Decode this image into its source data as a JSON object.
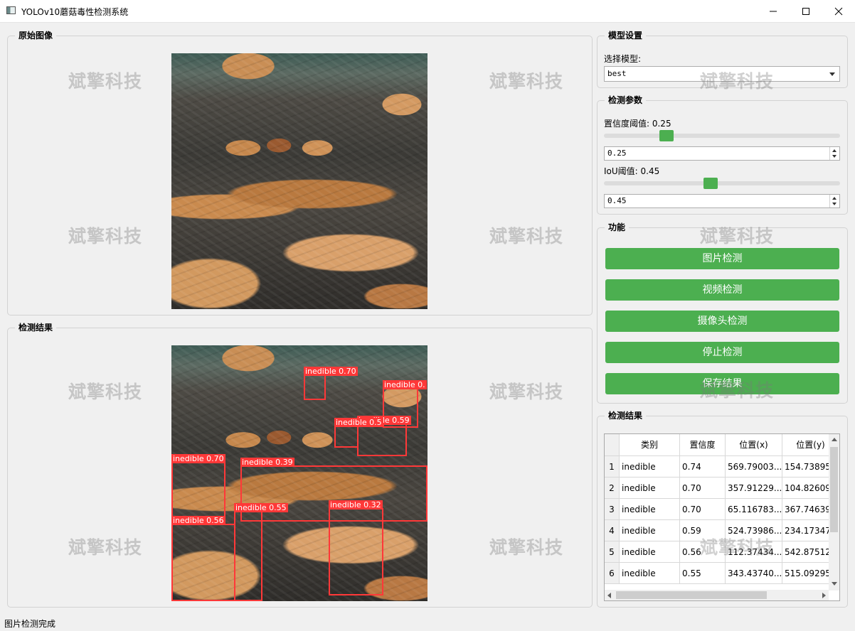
{
  "window": {
    "title": "YOLOv10蘑菇毒性检测系统"
  },
  "original_panel": {
    "title": "原始图像"
  },
  "result_panel": {
    "title": "检测结果",
    "detections": [
      {
        "label": "inedible 0.70"
      },
      {
        "label": "inedible 0."
      },
      {
        "label": "inedible 0.59"
      },
      {
        "label": "inedible 0.5"
      },
      {
        "label": "inedible 0.70"
      },
      {
        "label": "inedible 0.39"
      },
      {
        "label": "inedible 0.55"
      },
      {
        "label": "inedible 0.32"
      },
      {
        "label": "inedible 0.56"
      }
    ]
  },
  "watermark": "斌擎科技",
  "model_settings": {
    "title": "模型设置",
    "select_label": "选择模型:",
    "selected_model": "best"
  },
  "detect_params": {
    "title": "检测参数",
    "conf_label": "置信度阈值: 0.25",
    "conf_value": "0.25",
    "conf_fraction": 0.25,
    "iou_label": "IoU阈值: 0.45",
    "iou_value": "0.45",
    "iou_fraction": 0.45
  },
  "functions": {
    "title": "功能",
    "image_detect": "图片检测",
    "video_detect": "视频检测",
    "camera_detect": "摄像头检测",
    "stop_detect": "停止检测",
    "save_result": "保存结果"
  },
  "results_table": {
    "title": "检测结果",
    "headers": [
      "类别",
      "置信度",
      "位置(x)",
      "位置(y)"
    ],
    "rows": [
      {
        "index": "1",
        "class": "inedible",
        "conf": "0.74",
        "x": "569.79003...",
        "y": "154.73895..."
      },
      {
        "index": "2",
        "class": "inedible",
        "conf": "0.70",
        "x": "357.91229...",
        "y": "104.82609..."
      },
      {
        "index": "3",
        "class": "inedible",
        "conf": "0.70",
        "x": "65.116783...",
        "y": "367.74639..."
      },
      {
        "index": "4",
        "class": "inedible",
        "conf": "0.59",
        "x": "524.73986...",
        "y": "234.17347..."
      },
      {
        "index": "5",
        "class": "inedible",
        "conf": "0.56",
        "x": "112.37434...",
        "y": "542.87512..."
      },
      {
        "index": "6",
        "class": "inedible",
        "conf": "0.55",
        "x": "343.43740...",
        "y": "515.09295..."
      }
    ]
  },
  "status": "图片检测完成",
  "colors": {
    "accent": "#4caf50",
    "bbox": "#ff3838"
  }
}
